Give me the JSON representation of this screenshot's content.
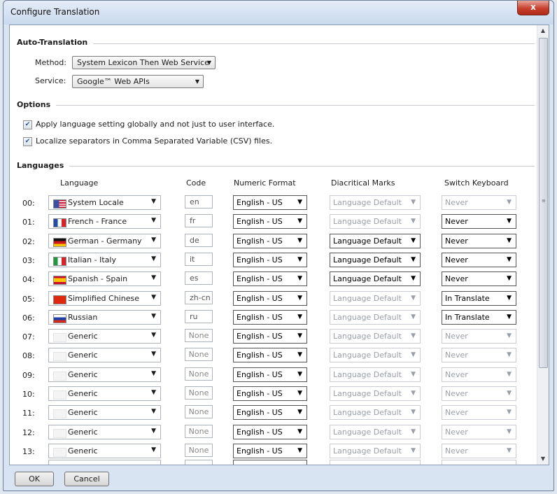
{
  "window": {
    "title": "Configure Translation",
    "close_glyph": "x"
  },
  "auto_translation": {
    "header": "Auto-Translation",
    "method_label": "Method:",
    "method_value": "System Lexicon Then Web Service",
    "service_label": "Service:",
    "service_value": "Google™ Web APIs"
  },
  "options": {
    "header": "Options",
    "items": [
      {
        "label": "Apply language setting globally and not just to user interface.",
        "checked": true
      },
      {
        "label": "Localize separators in Comma Separated Variable (CSV) files.",
        "checked": true
      }
    ]
  },
  "languages": {
    "header": "Languages",
    "columns": {
      "language": "Language",
      "code": "Code",
      "numeric": "Numeric Format",
      "diacritical": "Diacritical Marks",
      "keyboard": "Switch Keyboard"
    },
    "rows": [
      {
        "num": "00:",
        "lang": "System Locale",
        "flag": "us-flag-icon",
        "code": "en",
        "numeric": "English - US",
        "diacritical": "Language Default",
        "diacritical_enabled": false,
        "keyboard": "Never",
        "keyboard_enabled": false
      },
      {
        "num": "01:",
        "lang": "French - France",
        "flag": "france-flag-icon",
        "code": "fr",
        "numeric": "English - US",
        "diacritical": "Language Default",
        "diacritical_enabled": false,
        "keyboard": "Never",
        "keyboard_enabled": true
      },
      {
        "num": "02:",
        "lang": "German - Germany",
        "flag": "germany-flag-icon",
        "code": "de",
        "numeric": "English - US",
        "diacritical": "Language Default",
        "diacritical_enabled": true,
        "keyboard": "Never",
        "keyboard_enabled": true
      },
      {
        "num": "03:",
        "lang": "Italian - Italy",
        "flag": "italy-flag-icon",
        "code": "it",
        "numeric": "English - US",
        "diacritical": "Language Default",
        "diacritical_enabled": true,
        "keyboard": "Never",
        "keyboard_enabled": true
      },
      {
        "num": "04:",
        "lang": "Spanish - Spain",
        "flag": "spain-flag-icon",
        "code": "es",
        "numeric": "English - US",
        "diacritical": "Language Default",
        "diacritical_enabled": true,
        "keyboard": "Never",
        "keyboard_enabled": true
      },
      {
        "num": "05:",
        "lang": "Simplified Chinese",
        "flag": "china-flag-icon",
        "code": "zh-cn",
        "numeric": "English - US",
        "diacritical": "Language Default",
        "diacritical_enabled": false,
        "keyboard": "In Translate",
        "keyboard_enabled": true
      },
      {
        "num": "06:",
        "lang": "Russian",
        "flag": "russia-flag-icon",
        "code": "ru",
        "numeric": "English - US",
        "diacritical": "Language Default",
        "diacritical_enabled": false,
        "keyboard": "In Translate",
        "keyboard_enabled": true
      },
      {
        "num": "07:",
        "lang": "Generic",
        "flag": "blank-flag-icon",
        "code": "None",
        "numeric": "English - US",
        "diacritical": "Language Default",
        "diacritical_enabled": false,
        "keyboard": "Never",
        "keyboard_enabled": false
      },
      {
        "num": "08:",
        "lang": "Generic",
        "flag": "blank-flag-icon",
        "code": "None",
        "numeric": "English - US",
        "diacritical": "Language Default",
        "diacritical_enabled": false,
        "keyboard": "Never",
        "keyboard_enabled": false
      },
      {
        "num": "09:",
        "lang": "Generic",
        "flag": "blank-flag-icon",
        "code": "None",
        "numeric": "English - US",
        "diacritical": "Language Default",
        "diacritical_enabled": false,
        "keyboard": "Never",
        "keyboard_enabled": false
      },
      {
        "num": "10:",
        "lang": "Generic",
        "flag": "blank-flag-icon",
        "code": "None",
        "numeric": "English - US",
        "diacritical": "Language Default",
        "diacritical_enabled": false,
        "keyboard": "Never",
        "keyboard_enabled": false
      },
      {
        "num": "11:",
        "lang": "Generic",
        "flag": "blank-flag-icon",
        "code": "None",
        "numeric": "English - US",
        "diacritical": "Language Default",
        "diacritical_enabled": false,
        "keyboard": "Never",
        "keyboard_enabled": false
      },
      {
        "num": "12:",
        "lang": "Generic",
        "flag": "blank-flag-icon",
        "code": "None",
        "numeric": "English - US",
        "diacritical": "Language Default",
        "diacritical_enabled": false,
        "keyboard": "Never",
        "keyboard_enabled": false
      },
      {
        "num": "13:",
        "lang": "Generic",
        "flag": "blank-flag-icon",
        "code": "None",
        "numeric": "English - US",
        "diacritical": "Language Default",
        "diacritical_enabled": false,
        "keyboard": "Never",
        "keyboard_enabled": false
      }
    ]
  },
  "buttons": {
    "ok": "OK",
    "cancel": "Cancel"
  }
}
